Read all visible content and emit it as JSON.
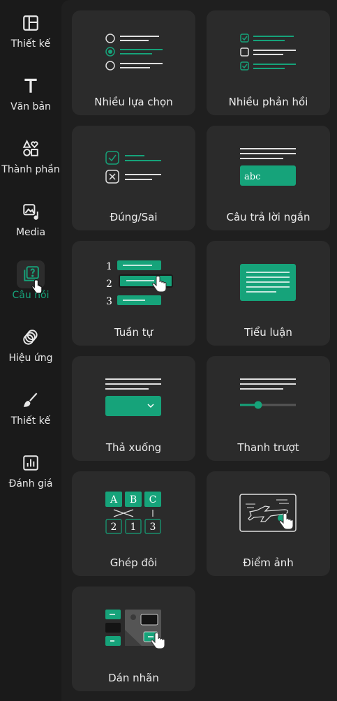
{
  "sidebar": {
    "items": [
      {
        "label": "Thiết kế",
        "icon": "layout-icon",
        "active": false
      },
      {
        "label": "Văn bản",
        "icon": "text-icon",
        "active": false
      },
      {
        "label": "Thành phần",
        "icon": "shapes-icon",
        "active": false
      },
      {
        "label": "Media",
        "icon": "media-icon",
        "active": false
      },
      {
        "label": "Câu hỏi",
        "icon": "question-icon",
        "active": true
      },
      {
        "label": "Hiệu ứng",
        "icon": "effects-icon",
        "active": false
      },
      {
        "label": "Thiết kế",
        "icon": "brush-icon",
        "active": false
      },
      {
        "label": "Đánh giá",
        "icon": "assessment-icon",
        "active": false
      }
    ]
  },
  "question_types": [
    {
      "label": "Nhiều lựa chọn"
    },
    {
      "label": "Nhiều phản hồi"
    },
    {
      "label": "Đúng/Sai"
    },
    {
      "label": "Câu trả lời ngắn",
      "sample_text": "abc"
    },
    {
      "label": "Tuần tự",
      "numbers": [
        "1",
        "2",
        "3"
      ]
    },
    {
      "label": "Tiểu luận"
    },
    {
      "label": "Thả xuống"
    },
    {
      "label": "Thanh trượt"
    },
    {
      "label": "Ghép đôi",
      "letters": [
        "A",
        "B",
        "C"
      ],
      "numbers": [
        "2",
        "1",
        "3"
      ]
    },
    {
      "label": "Điểm ảnh"
    },
    {
      "label": "Dán nhãn"
    }
  ],
  "colors": {
    "accent": "#16a37a",
    "background": "#1a1a1a",
    "card": "#2b2b2b",
    "text": "#ececec"
  }
}
